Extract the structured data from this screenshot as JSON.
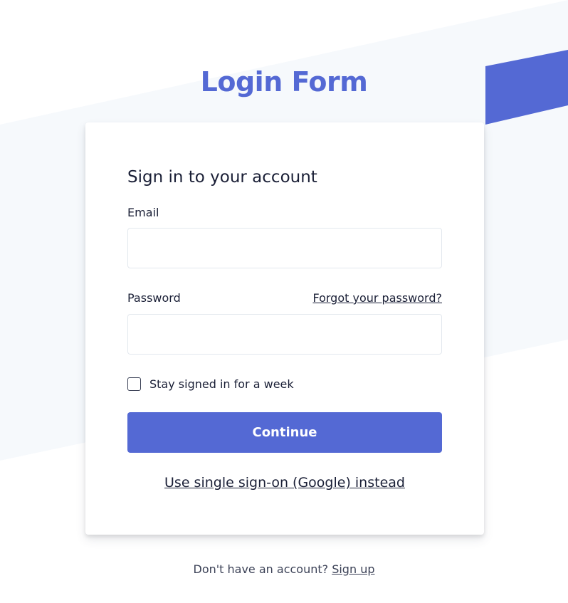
{
  "page": {
    "title": "Login Form"
  },
  "colors": {
    "accent": "#5469d4",
    "text": "#1a1f36",
    "background_tint": "#f6f9fc"
  },
  "card": {
    "heading": "Sign in to your account",
    "email_label": "Email",
    "email_value": "",
    "password_label": "Password",
    "password_value": "",
    "forgot_link": "Forgot your password?",
    "remember_label": "Stay signed in for a week",
    "remember_checked": false,
    "continue_button": "Continue",
    "sso_link": "Use single sign-on (Google) instead"
  },
  "footer": {
    "prompt": "Don't have an account?",
    "signup_link": "Sign up"
  }
}
